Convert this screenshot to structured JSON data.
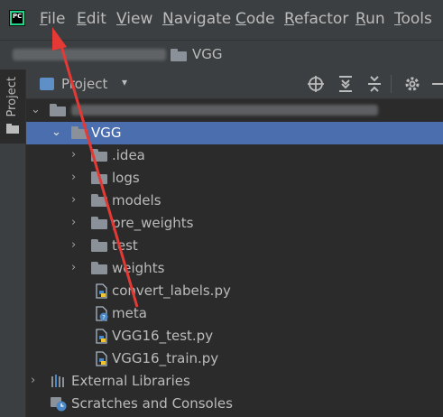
{
  "menu": {
    "items": [
      {
        "mnemonic": "F",
        "rest": "ile"
      },
      {
        "mnemonic": "E",
        "rest": "dit"
      },
      {
        "mnemonic": "V",
        "rest": "iew"
      },
      {
        "mnemonic": "N",
        "rest": "avigate"
      },
      {
        "mnemonic": "C",
        "rest": "ode"
      },
      {
        "mnemonic": "R",
        "rest": "efactor"
      },
      {
        "mnemonic": "R",
        "rest": "un"
      },
      {
        "mnemonic": "T",
        "rest": "ools"
      }
    ]
  },
  "breadcrumb": {
    "current": "VGG"
  },
  "left_strip": {
    "project_tab": "Project"
  },
  "panel": {
    "title": "Project",
    "caret": "▾"
  },
  "tree": {
    "subfolder": "VGG",
    "folders": [
      ".idea",
      "logs",
      "models",
      "pre_weights",
      "test",
      "weights"
    ],
    "files": [
      "convert_labels.py",
      "meta",
      "VGG16_test.py",
      "VGG16_train.py"
    ],
    "external_libraries": "External Libraries",
    "scratches": "Scratches and Consoles"
  },
  "colors": {
    "selection": "#4b6eaf",
    "annotation_arrow": "#e53935",
    "pycharm_logo": "#21d789"
  }
}
